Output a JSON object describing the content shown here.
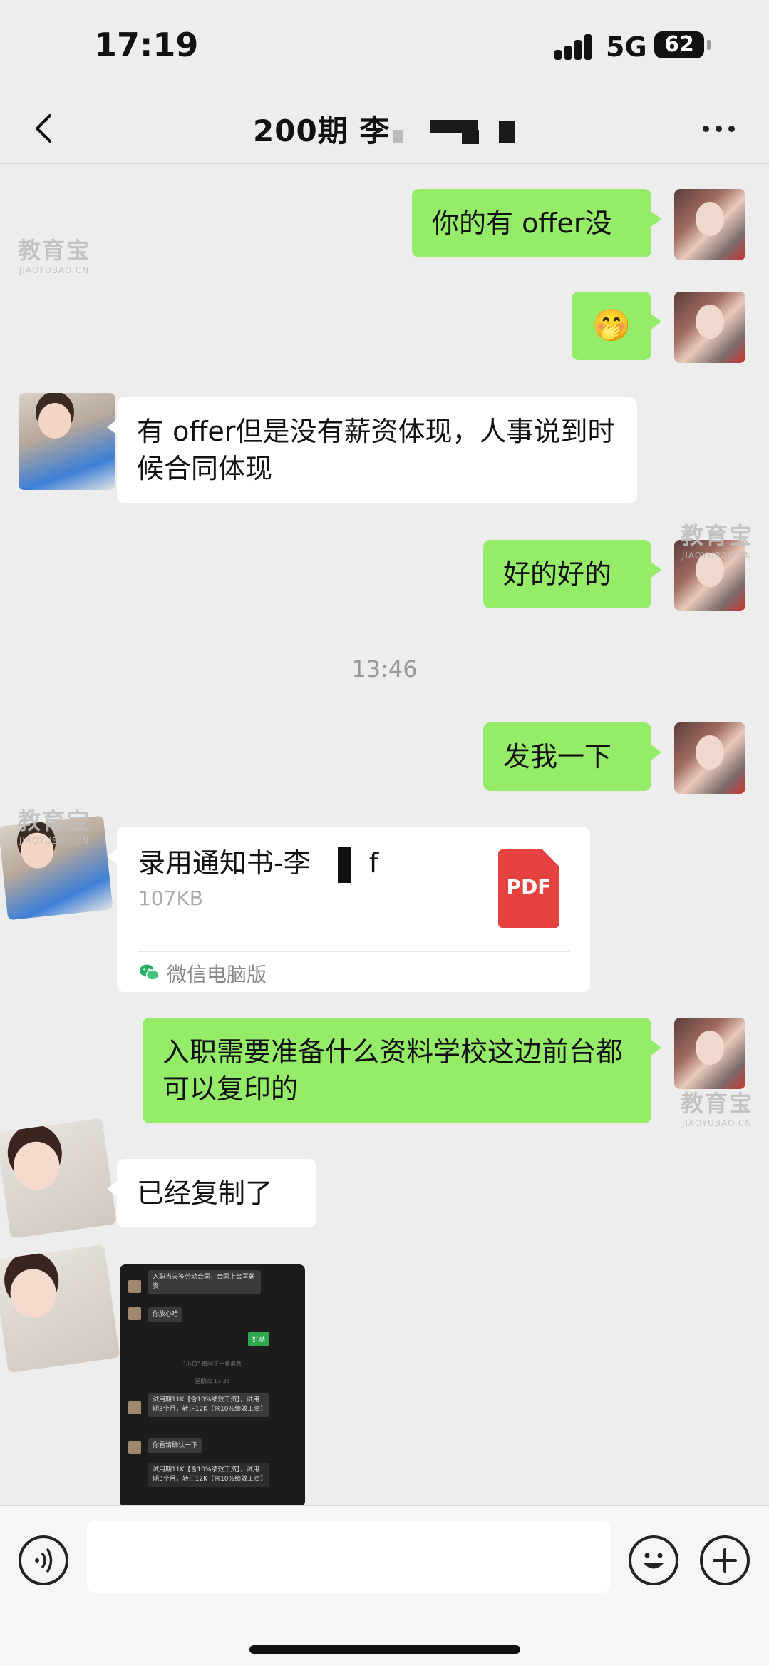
{
  "status_bar": {
    "time": "17:19",
    "network": "5G",
    "battery": "62"
  },
  "header": {
    "title": "200期 李"
  },
  "watermark": {
    "brand": "教育宝",
    "url": "JIAOYUBAO.CN"
  },
  "messages": [
    {
      "side": "out",
      "text": "你的有 offer没"
    },
    {
      "side": "out",
      "text": "🤭"
    },
    {
      "side": "in",
      "text": "有 offer但是没有薪资体现，人事说到时候合同体现"
    },
    {
      "side": "out",
      "text": "好的好的"
    },
    {
      "side": "out",
      "text": "发我一下"
    },
    {
      "side": "in",
      "text": "已经复制了"
    },
    {
      "side": "out",
      "text": "入职需要准备什么资料学校这边前台都可以复印的"
    }
  ],
  "timestamp": "13:46",
  "file": {
    "name": "录用通知书-李",
    "ext": "f",
    "size": "107KB",
    "type_label": "PDF",
    "source": "微信电脑版"
  },
  "screenshot_msg": {
    "lines": [
      "入职当天签劳动合同，合同上会写薪资",
      "你放心哈",
      "好哒",
      "\"小白\" 撤回了一条消息",
      "星期四 17:35",
      "试用期11K【含10%绩效工资】，试用期3个月，转正12K【含10%绩效工资】",
      "你看请确认一下",
      "试用期11K【含10%绩效工资】，试用期3个月，转正12K【含10%绩效工资】"
    ]
  },
  "input": {
    "placeholder": ""
  }
}
